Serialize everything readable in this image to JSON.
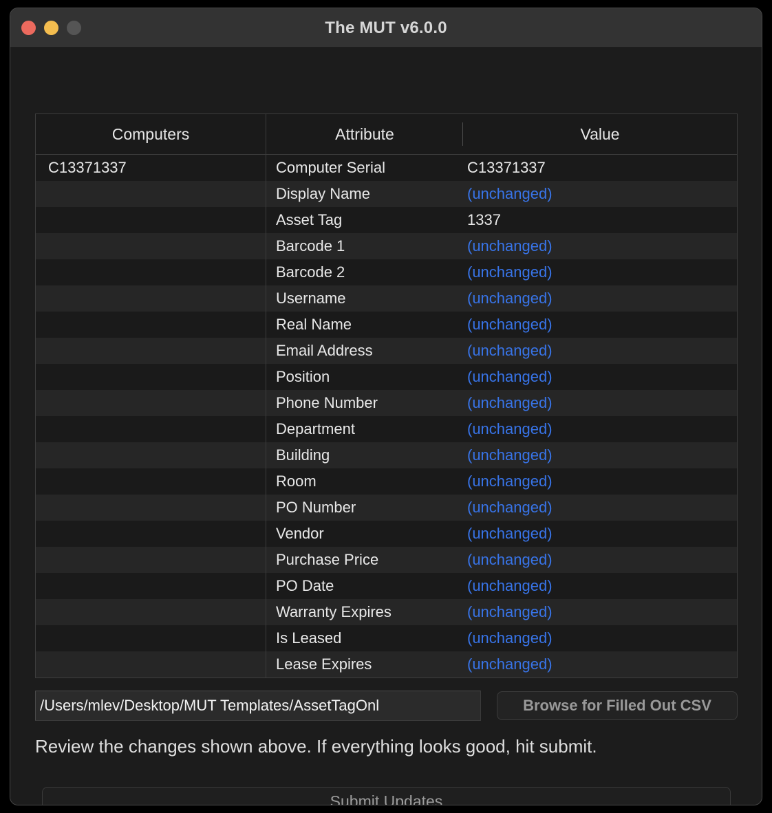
{
  "window": {
    "title": "The MUT v6.0.0",
    "traffic_lights": [
      {
        "name": "close",
        "color": "#ec6a5e"
      },
      {
        "name": "minimize",
        "color": "#f4bd4f"
      },
      {
        "name": "zoom",
        "color": "#555555"
      }
    ]
  },
  "table": {
    "headers": {
      "computers": "Computers",
      "attribute": "Attribute",
      "value": "Value"
    },
    "computers": [
      "C13371337"
    ],
    "unchanged_label": "(unchanged)",
    "unchanged_color": "#3874e8",
    "rows": [
      {
        "computer": "C13371337",
        "attribute": "Computer Serial",
        "value": "C13371337",
        "unchanged": false
      },
      {
        "computer": "",
        "attribute": "Display Name",
        "value": "(unchanged)",
        "unchanged": true
      },
      {
        "computer": "",
        "attribute": "Asset Tag",
        "value": "1337",
        "unchanged": false
      },
      {
        "computer": "",
        "attribute": "Barcode 1",
        "value": "(unchanged)",
        "unchanged": true
      },
      {
        "computer": "",
        "attribute": "Barcode 2",
        "value": "(unchanged)",
        "unchanged": true
      },
      {
        "computer": "",
        "attribute": "Username",
        "value": "(unchanged)",
        "unchanged": true
      },
      {
        "computer": "",
        "attribute": "Real Name",
        "value": "(unchanged)",
        "unchanged": true
      },
      {
        "computer": "",
        "attribute": "Email Address",
        "value": "(unchanged)",
        "unchanged": true
      },
      {
        "computer": "",
        "attribute": "Position",
        "value": "(unchanged)",
        "unchanged": true
      },
      {
        "computer": "",
        "attribute": "Phone Number",
        "value": "(unchanged)",
        "unchanged": true
      },
      {
        "computer": "",
        "attribute": "Department",
        "value": "(unchanged)",
        "unchanged": true
      },
      {
        "computer": "",
        "attribute": "Building",
        "value": "(unchanged)",
        "unchanged": true
      },
      {
        "computer": "",
        "attribute": "Room",
        "value": "(unchanged)",
        "unchanged": true
      },
      {
        "computer": "",
        "attribute": "PO Number",
        "value": "(unchanged)",
        "unchanged": true
      },
      {
        "computer": "",
        "attribute": "Vendor",
        "value": "(unchanged)",
        "unchanged": true
      },
      {
        "computer": "",
        "attribute": "Purchase Price",
        "value": "(unchanged)",
        "unchanged": true
      },
      {
        "computer": "",
        "attribute": "PO Date",
        "value": "(unchanged)",
        "unchanged": true
      },
      {
        "computer": "",
        "attribute": "Warranty Expires",
        "value": "(unchanged)",
        "unchanged": true
      },
      {
        "computer": "",
        "attribute": "Is Leased",
        "value": "(unchanged)",
        "unchanged": true
      },
      {
        "computer": "",
        "attribute": "Lease Expires",
        "value": "(unchanged)",
        "unchanged": true
      }
    ]
  },
  "controls": {
    "csv_path_value": "/Users/mlev/Desktop/MUT Templates/AssetTagOnl",
    "csv_path_placeholder": "",
    "browse_label": "Browse for Filled Out CSV",
    "instruction": "Review the changes shown above. If everything looks good, hit submit.",
    "submit_label": "Submit Updates"
  }
}
